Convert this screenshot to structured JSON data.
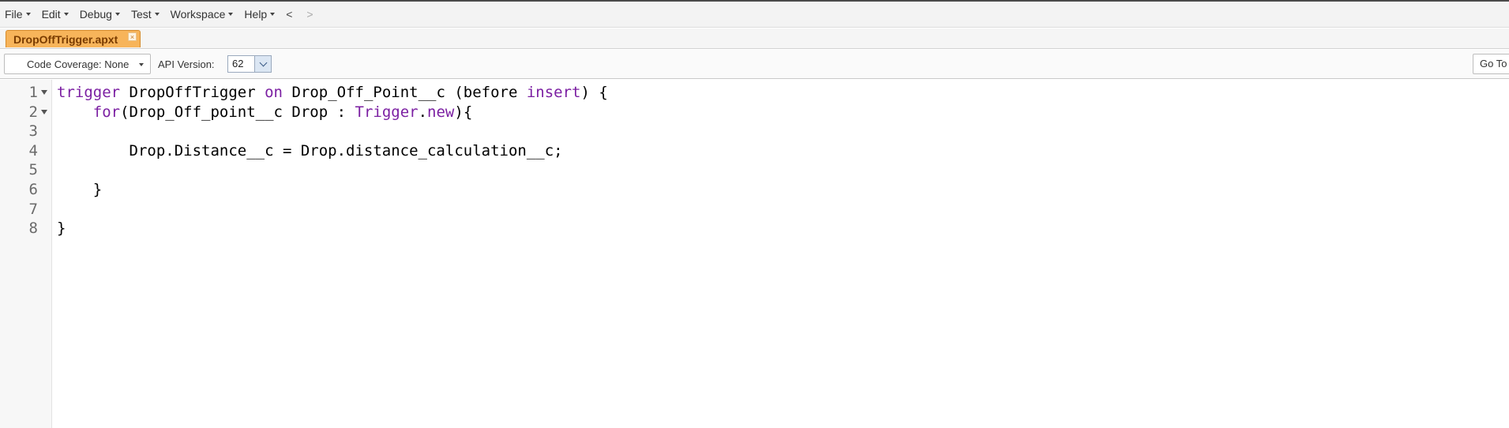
{
  "menu": {
    "items": [
      {
        "label": "File"
      },
      {
        "label": "Edit"
      },
      {
        "label": "Debug"
      },
      {
        "label": "Test"
      },
      {
        "label": "Workspace"
      },
      {
        "label": "Help"
      }
    ],
    "back_label": "<",
    "forward_label": ">"
  },
  "tabs": [
    {
      "label": "DropOffTrigger.apxt",
      "close_label": "×"
    }
  ],
  "toolbar": {
    "coverage_label": "Code Coverage: None",
    "api_label": "API Version:",
    "api_value": "62",
    "goto_label": "Go To"
  },
  "editor": {
    "language": "apex",
    "keyword_color": "#7b1fa2",
    "lines": [
      {
        "num": "1",
        "fold": true,
        "tokens": [
          {
            "t": "trigger",
            "kw": true
          },
          {
            "t": " DropOffTrigger "
          },
          {
            "t": "on",
            "kw": true
          },
          {
            "t": " Drop_Off_Point__c (before "
          },
          {
            "t": "insert",
            "kw": true
          },
          {
            "t": ") {"
          }
        ]
      },
      {
        "num": "2",
        "fold": true,
        "tokens": [
          {
            "t": "    "
          },
          {
            "t": "for",
            "kw": true
          },
          {
            "t": "(Drop_Off_point__c Drop : "
          },
          {
            "t": "Trigger",
            "kw": true
          },
          {
            "t": "."
          },
          {
            "t": "new",
            "kw": true
          },
          {
            "t": "){"
          }
        ]
      },
      {
        "num": "3",
        "fold": false,
        "tokens": []
      },
      {
        "num": "4",
        "fold": false,
        "tokens": [
          {
            "t": "        Drop.Distance__c = Drop.distance_calculation__c;"
          }
        ]
      },
      {
        "num": "5",
        "fold": false,
        "tokens": []
      },
      {
        "num": "6",
        "fold": false,
        "tokens": [
          {
            "t": "    }"
          }
        ]
      },
      {
        "num": "7",
        "fold": false,
        "tokens": []
      },
      {
        "num": "8",
        "fold": false,
        "tokens": [
          {
            "t": "}"
          }
        ]
      }
    ]
  }
}
